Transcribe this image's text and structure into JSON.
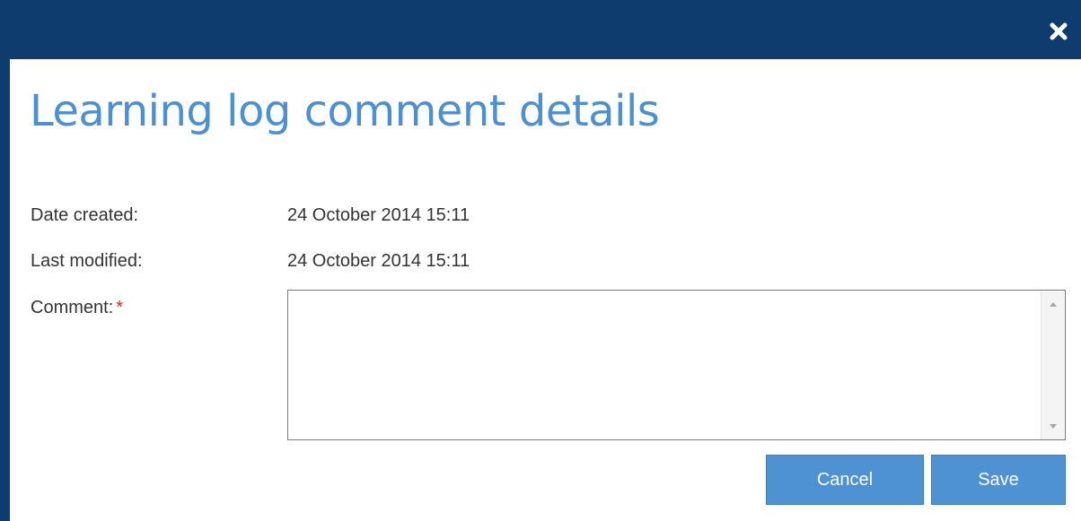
{
  "dialog": {
    "title": "Learning log comment details",
    "close_icon": "close-icon"
  },
  "fields": {
    "date_created": {
      "label": "Date created:",
      "value": "24 October 2014 15:11"
    },
    "last_modified": {
      "label": "Last modified:",
      "value": "24 October 2014 15:11"
    },
    "comment": {
      "label": "Comment:",
      "required_mark": "*",
      "value": ""
    }
  },
  "buttons": {
    "cancel_label": "Cancel",
    "save_label": "Save"
  },
  "colors": {
    "titlebar": "#0e3c6e",
    "heading": "#4a90d2",
    "button": "#4f92d3",
    "required": "#d9261c"
  }
}
